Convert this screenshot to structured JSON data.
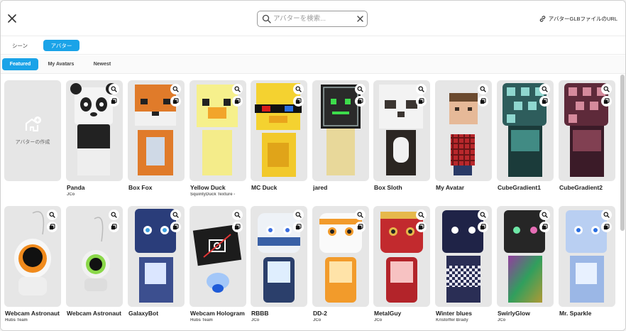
{
  "header": {
    "close_icon": "close-icon",
    "search": {
      "placeholder": "アバターを検索..."
    },
    "glb_link": "アバターGLBファイルのURL"
  },
  "tabs": [
    {
      "label": "シーン",
      "selected": false
    },
    {
      "label": "アバター",
      "selected": true
    }
  ],
  "filters": [
    {
      "label": "Featured",
      "selected": true
    },
    {
      "label": "My Avatars",
      "selected": false
    },
    {
      "label": "Newest",
      "selected": false
    }
  ],
  "create": {
    "label": "アバターの作成"
  },
  "avatars": [
    {
      "name": "Panda",
      "author": "JCo"
    },
    {
      "name": "Box Fox",
      "author": ""
    },
    {
      "name": "Yellow Duck",
      "author": "SquintyDuck Texture -"
    },
    {
      "name": "MC Duck",
      "author": ""
    },
    {
      "name": "jared",
      "author": ""
    },
    {
      "name": "Box Sloth",
      "author": ""
    },
    {
      "name": "My Avatar",
      "author": ""
    },
    {
      "name": "CubeGradient1",
      "author": ""
    },
    {
      "name": "CubeGradient2",
      "author": ""
    },
    {
      "name": "Webcam Astronaut",
      "author": "Hubs Team"
    },
    {
      "name": "Webcam Astronaut",
      "author": ""
    },
    {
      "name": "GalaxyBot",
      "author": ""
    },
    {
      "name": "Webcam Hologram",
      "author": "Hubs Team"
    },
    {
      "name": "RBBB",
      "author": "JCo"
    },
    {
      "name": "DD-2",
      "author": "JCo"
    },
    {
      "name": "MetalGuy",
      "author": "JCo"
    },
    {
      "name": "Winter blues",
      "author": "Kristoffer Brady"
    },
    {
      "name": "SwirlyGlow",
      "author": "JCo"
    },
    {
      "name": "Mr. Sparkle",
      "author": ""
    }
  ],
  "colors": {
    "accent": "#1aa3e8",
    "card_bg": "#e6e6e6"
  }
}
